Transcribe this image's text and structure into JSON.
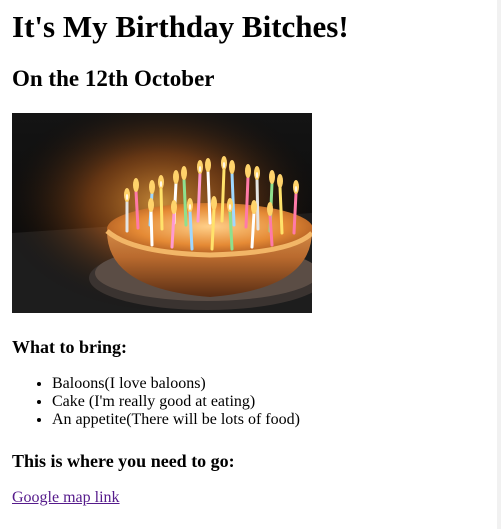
{
  "heading": "It's My Birthday Bitches!",
  "subheading": "On the 12th October",
  "bring": {
    "title": "What to bring:",
    "items": [
      "Baloons(I love baloons)",
      "Cake (I'm really good at eating)",
      "An appetite(There will be lots of food)"
    ]
  },
  "directions": {
    "title": "This is where you need to go:",
    "link": "Google map link"
  }
}
